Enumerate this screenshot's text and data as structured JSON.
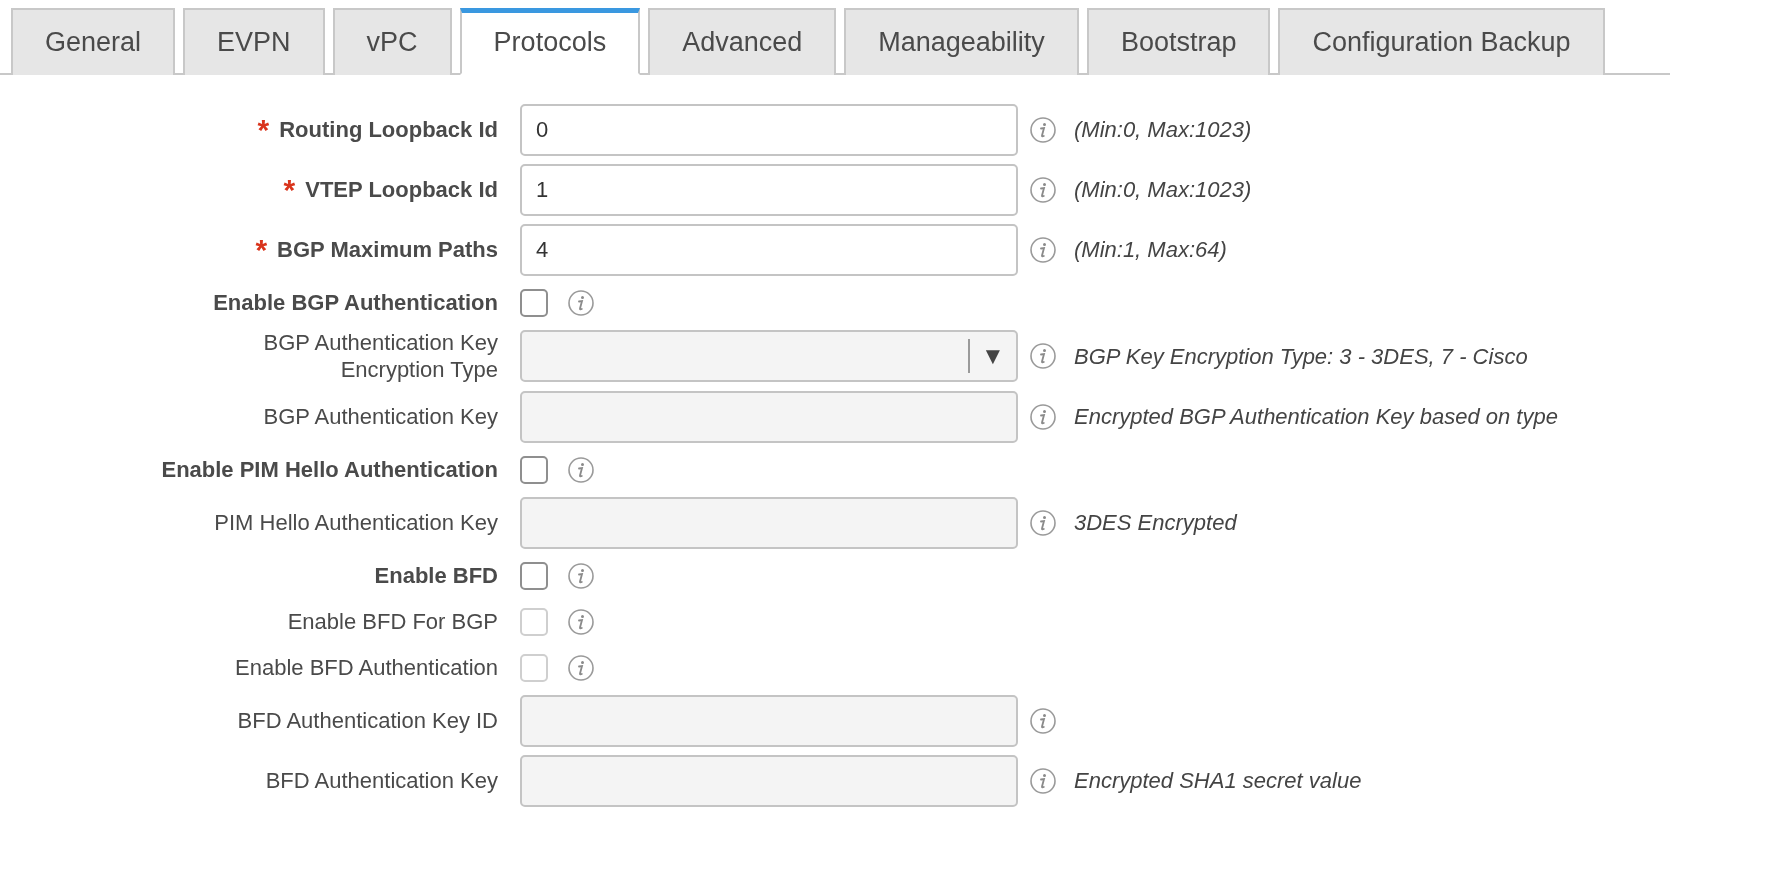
{
  "tabs": [
    {
      "label": "General",
      "selected": false
    },
    {
      "label": "EVPN",
      "selected": false
    },
    {
      "label": "vPC",
      "selected": false
    },
    {
      "label": "Protocols",
      "selected": true
    },
    {
      "label": "Advanced",
      "selected": false
    },
    {
      "label": "Manageability",
      "selected": false
    },
    {
      "label": "Bootstrap",
      "selected": false
    },
    {
      "label": "Configuration Backup",
      "selected": false
    }
  ],
  "fields": [
    {
      "kind": "text",
      "label": "Routing Loopback Id",
      "required_mark": "*",
      "disabled": false,
      "value": "0",
      "hint": "(Min:0, Max:1023)"
    },
    {
      "kind": "text",
      "label": "VTEP Loopback Id",
      "required_mark": "*",
      "disabled": false,
      "value": "1",
      "hint": "(Min:0, Max:1023)"
    },
    {
      "kind": "text",
      "label": "BGP Maximum Paths",
      "required_mark": "*",
      "disabled": false,
      "value": "4",
      "hint": "(Min:1, Max:64)"
    },
    {
      "kind": "checkbox",
      "label": "Enable BGP Authentication",
      "disabled": false,
      "checked": false
    },
    {
      "kind": "select",
      "label": "BGP Authentication Key\nEncryption Type",
      "disabled": true,
      "caret": "▼",
      "hint": "BGP Key Encryption Type: 3 - 3DES, 7 - Cisco"
    },
    {
      "kind": "text",
      "label": "BGP Authentication Key",
      "disabled": true,
      "hint": "Encrypted BGP Authentication Key based on type"
    },
    {
      "kind": "checkbox",
      "label": "Enable PIM Hello Authentication",
      "disabled": false,
      "checked": false
    },
    {
      "kind": "text",
      "label": "PIM Hello Authentication Key",
      "disabled": true,
      "hint": "3DES Encrypted"
    },
    {
      "kind": "checkbox",
      "label": "Enable BFD",
      "disabled": false,
      "checked": false
    },
    {
      "kind": "checkbox",
      "label": "Enable BFD For BGP",
      "disabled": true,
      "checked": false
    },
    {
      "kind": "checkbox",
      "label": "Enable BFD Authentication",
      "disabled": true,
      "checked": false
    },
    {
      "kind": "text",
      "label": "BFD Authentication Key ID",
      "disabled": true
    },
    {
      "kind": "text",
      "label": "BFD Authentication Key",
      "disabled": true,
      "hint": "Encrypted SHA1 secret value"
    }
  ]
}
